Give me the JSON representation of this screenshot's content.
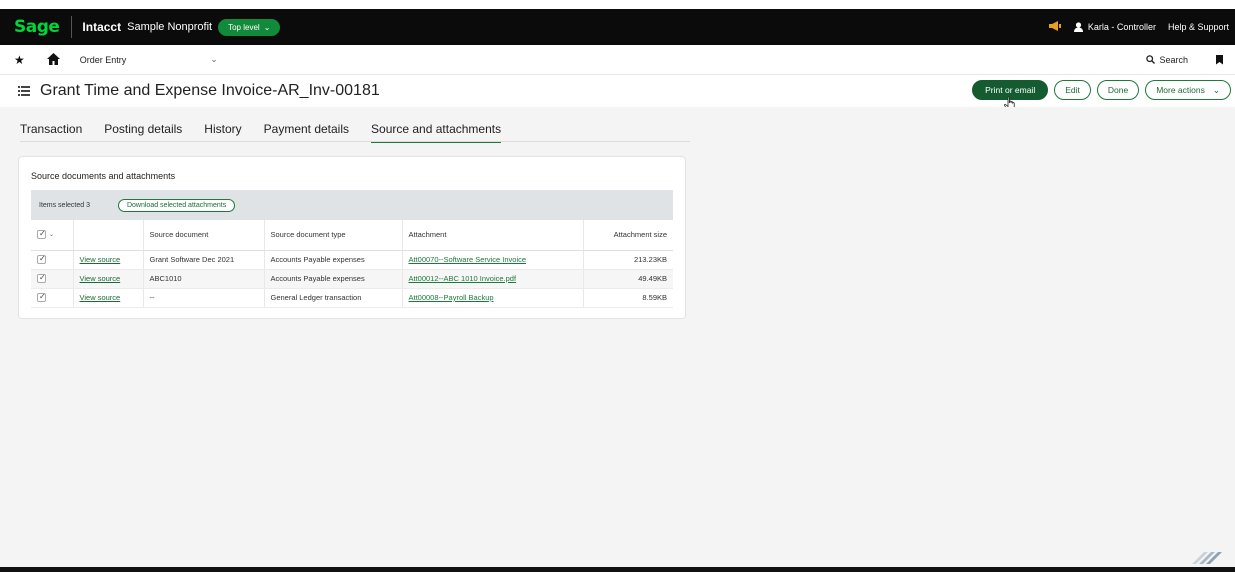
{
  "topbar": {
    "logo": "Sage",
    "app_name": "Intacct",
    "company": "Sample Nonprofit",
    "level": "Top level",
    "user": "Karla - Controller",
    "help": "Help & Support"
  },
  "nav": {
    "module": "Order Entry",
    "search": "Search"
  },
  "page": {
    "title": "Grant Time and Expense Invoice-AR_Inv-00181",
    "actions": {
      "print": "Print or email",
      "edit": "Edit",
      "done": "Done",
      "more": "More actions"
    }
  },
  "tabs": [
    {
      "label": "Transaction",
      "active": false
    },
    {
      "label": "Posting details",
      "active": false
    },
    {
      "label": "History",
      "active": false
    },
    {
      "label": "Payment details",
      "active": false
    },
    {
      "label": "Source and attachments",
      "active": true
    }
  ],
  "card": {
    "title": "Source documents and attachments",
    "items_selected": "Items selected 3",
    "download_label": "Download selected attachments",
    "columns": [
      "Source document",
      "Source document type",
      "Attachment",
      "Attachment size"
    ],
    "rows": [
      {
        "link": "View source",
        "source": "Grant Software Dec 2021",
        "type": "Accounts Payable expenses",
        "attachment": "Att00070--Software Service Invoice",
        "size": "213.23KB"
      },
      {
        "link": "View source",
        "source": "ABC1010",
        "type": "Accounts Payable expenses",
        "attachment": "Att00012--ABC 1010 Invoice.pdf",
        "size": "49.49KB"
      },
      {
        "link": "View source",
        "source": "--",
        "type": "General Ledger transaction",
        "attachment": "Att00008--Payroll Backup",
        "size": "8.59KB"
      }
    ]
  },
  "colors": {
    "brand_green": "#00d639",
    "accent_green": "#1c7a3b",
    "primary_button": "#145c30",
    "topbar_bg": "#0b0b0b"
  }
}
